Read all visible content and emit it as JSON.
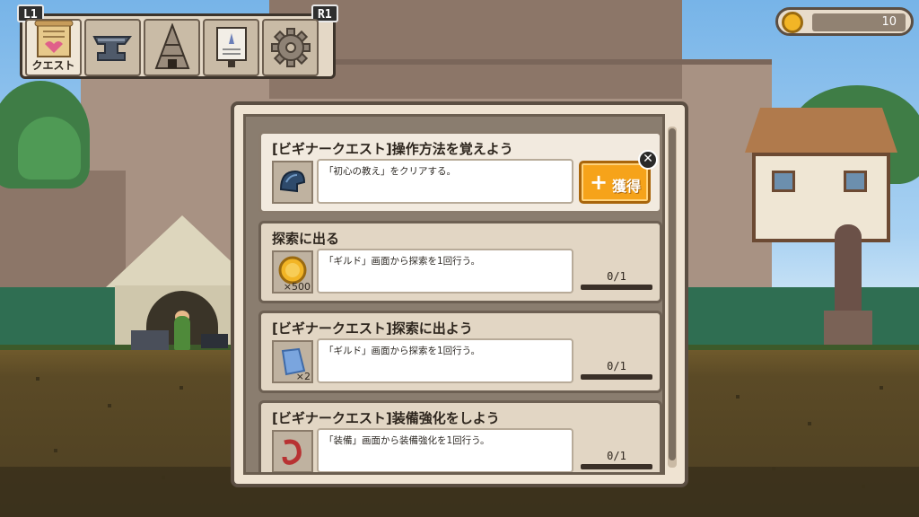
{
  "menu": {
    "left_shoulder": "L1",
    "right_shoulder": "R1",
    "items": [
      {
        "icon": "quest-scroll-icon",
        "label": "クエスト",
        "active": true
      },
      {
        "icon": "anvil-icon",
        "label": "",
        "active": false
      },
      {
        "icon": "tower-icon",
        "label": "",
        "active": false
      },
      {
        "icon": "notice-board-icon",
        "label": "",
        "active": false
      },
      {
        "icon": "gear-icon",
        "label": "",
        "active": false
      }
    ]
  },
  "currency": {
    "icon": "coin-icon",
    "value": "10"
  },
  "quests": [
    {
      "title": "[ビギナークエスト]操作方法を覚えよう",
      "description": "「初心の教え」をクリアする。",
      "reward_icon": "blue-helmet-icon",
      "reward_qty": "",
      "progress": "",
      "claim_label": "獲得",
      "claimable": true
    },
    {
      "title": "探索に出る",
      "description": "「ギルド」画面から探索を1回行う。",
      "reward_icon": "gold-coin-icon",
      "reward_qty": "×500",
      "progress": "0/1",
      "claimable": false
    },
    {
      "title": "[ビギナークエスト]探索に出よう",
      "description": "「ギルド」画面から探索を1回行う。",
      "reward_icon": "blue-cloth-icon",
      "reward_qty": "×2",
      "progress": "0/1",
      "claimable": false
    },
    {
      "title": "[ビギナークエスト]装備強化をしよう",
      "description": "「装備」画面から装備強化を1回行う。",
      "reward_icon": "red-ring-icon",
      "reward_qty": "",
      "progress": "0/1",
      "claimable": false
    }
  ],
  "colors": {
    "accent": "#f6a31a",
    "panel": "#efe3d2",
    "coin": "#f2b526"
  }
}
